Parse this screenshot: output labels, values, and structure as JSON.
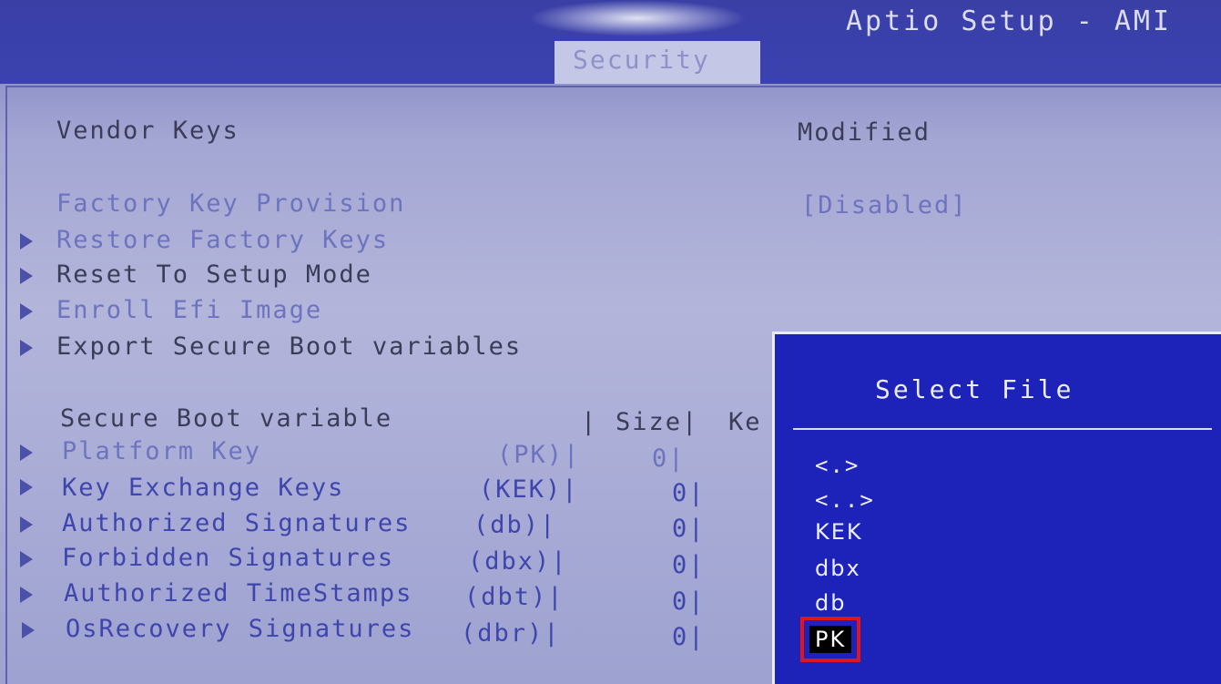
{
  "header": {
    "app_title": "Aptio Setup - AMI",
    "active_tab": "Security"
  },
  "settings": {
    "vendor_keys_label": "Vendor Keys",
    "vendor_keys_value": "Modified",
    "factory_key_provision_label": "Factory Key Provision",
    "factory_key_provision_value": "[Disabled]",
    "submenus": [
      "Restore Factory Keys",
      "Reset To Setup Mode",
      "Enroll Efi Image",
      "Export Secure Boot variables"
    ]
  },
  "variables_table": {
    "header_name": "Secure Boot variable",
    "header_sep": "|",
    "header_size": "Size|",
    "header_key_truncated": "Ke",
    "rows": [
      {
        "name": "Platform Key",
        "abbr": "(PK)|",
        "size": "0|"
      },
      {
        "name": "Key Exchange Keys",
        "abbr": "(KEK)|",
        "size": "0|"
      },
      {
        "name": "Authorized Signatures",
        "abbr": "(db)|",
        "size": "0|"
      },
      {
        "name": "Forbidden  Signatures",
        "abbr": "(dbx)|",
        "size": "0|"
      },
      {
        "name": "Authorized TimeStamps",
        "abbr": "(dbt)|",
        "size": "0|"
      },
      {
        "name": "OsRecovery Signatures",
        "abbr": "(dbr)|",
        "size": "0|"
      }
    ]
  },
  "select_file_dialog": {
    "title": "Select File",
    "items": [
      "<.>",
      "<..>",
      "KEK",
      "dbx",
      "db",
      "PK"
    ],
    "selected_item": "PK",
    "highlight_color": "#e0161b"
  }
}
